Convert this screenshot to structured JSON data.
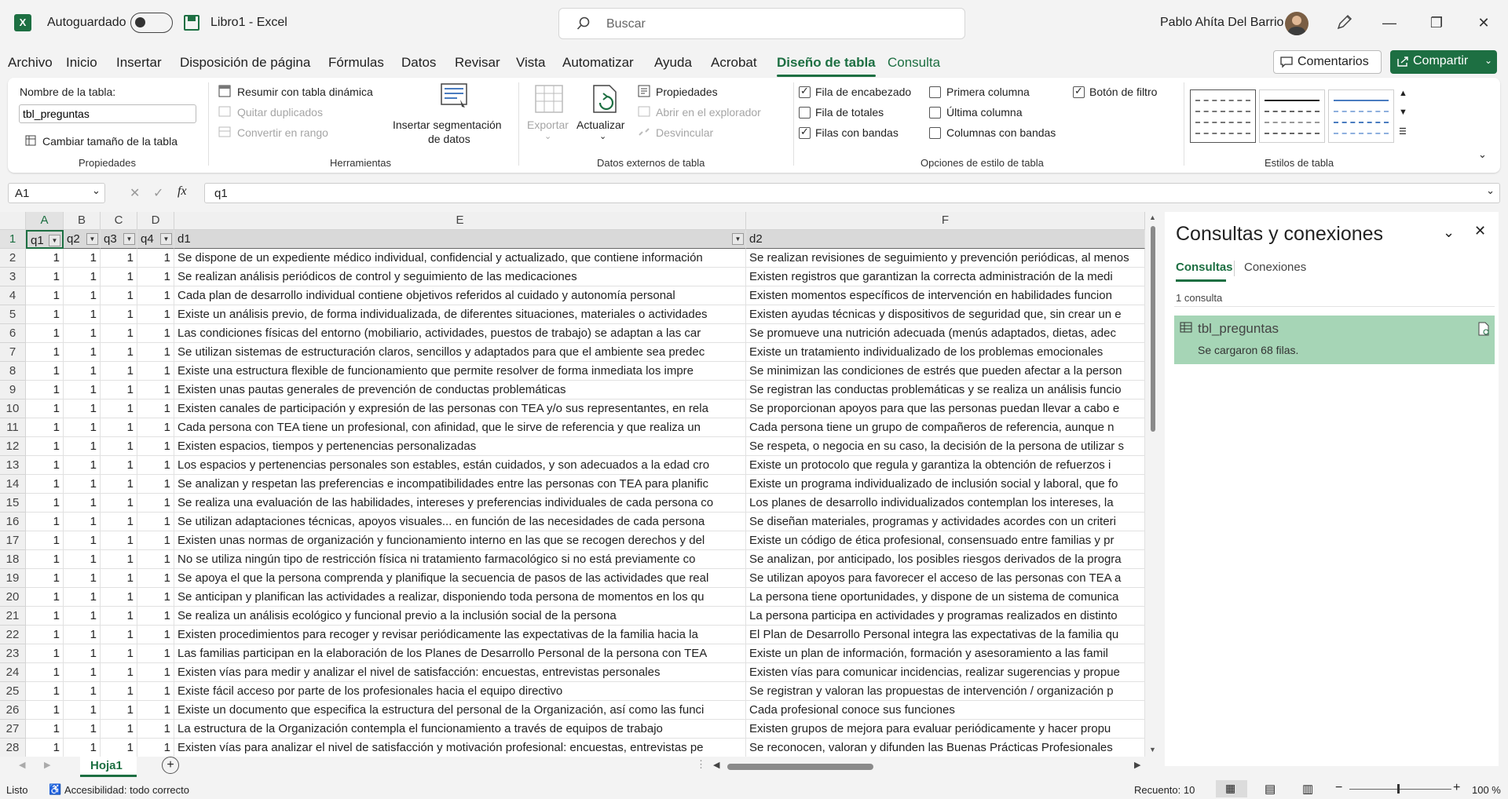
{
  "titlebar": {
    "app_logo": "X",
    "autosave_label": "Autoguardado",
    "autosave_state": "off",
    "doc_title": "Libro1  -  Excel",
    "search_placeholder": "Buscar",
    "user_name": "Pablo Ahíta Del Barrio"
  },
  "menu": {
    "tabs": [
      "Archivo",
      "Inicio",
      "Insertar",
      "Disposición de página",
      "Fórmulas",
      "Datos",
      "Revisar",
      "Vista",
      "Automatizar",
      "Ayuda",
      "Acrobat",
      "Diseño de tabla",
      "Consulta"
    ],
    "active_tab": "Diseño de tabla",
    "comments_label": "Comentarios",
    "share_label": "Compartir"
  },
  "ribbon": {
    "propiedades": {
      "table_name_label": "Nombre de la tabla:",
      "table_name_value": "tbl_preguntas",
      "resize_label": "Cambiar tamaño de la tabla",
      "group_label": "Propiedades"
    },
    "herramientas": {
      "pivot_label": "Resumir con tabla dinámica",
      "dedupe_label": "Quitar duplicados",
      "convert_label": "Convertir en rango",
      "slicer_label_1": "Insertar segmentación",
      "slicer_label_2": "de datos",
      "group_label": "Herramientas"
    },
    "datos_externos": {
      "export_label": "Exportar",
      "refresh_label": "Actualizar",
      "properties_label": "Propiedades",
      "open_browser_label": "Abrir en el explorador",
      "unlink_label": "Desvincular",
      "group_label": "Datos externos de tabla"
    },
    "opciones_estilo": {
      "header_row": "Fila de encabezado",
      "total_row": "Fila de totales",
      "banded_rows": "Filas con bandas",
      "first_col": "Primera columna",
      "last_col": "Última columna",
      "banded_cols": "Columnas con bandas",
      "filter_button": "Botón de filtro",
      "group_label": "Opciones de estilo de tabla"
    },
    "estilos": {
      "group_label": "Estilos de tabla"
    }
  },
  "formula": {
    "name_box": "A1",
    "fx": "fx",
    "content": "q1"
  },
  "grid": {
    "column_letters": [
      "A",
      "B",
      "C",
      "D",
      "E",
      "F"
    ],
    "header_row": [
      "q1",
      "q2",
      "q3",
      "q4",
      "d1",
      "d2"
    ],
    "rows": [
      {
        "n": "2",
        "q": [
          "1",
          "1",
          "1",
          "1"
        ],
        "d1": "Se dispone de un expediente médico individual, confidencial y actualizado, que contiene información",
        "d2": "Se realizan revisiones de seguimiento y prevención periódicas, al menos"
      },
      {
        "n": "3",
        "q": [
          "1",
          "1",
          "1",
          "1"
        ],
        "d1": "Se realizan análisis periódicos de control y seguimiento de las medicaciones",
        "d2": "Existen registros que garantizan la correcta administración de la medi"
      },
      {
        "n": "4",
        "q": [
          "1",
          "1",
          "1",
          "1"
        ],
        "d1": "Cada plan de desarrollo individual contiene objetivos referidos al cuidado y autonomía personal",
        "d2": "Existen momentos específicos de intervención en habilidades funcion"
      },
      {
        "n": "5",
        "q": [
          "1",
          "1",
          "1",
          "1"
        ],
        "d1": "Existe un análisis previo, de forma individualizada, de diferentes situaciones, materiales o actividades",
        "d2": "Existen ayudas técnicas y dispositivos de seguridad que, sin crear un e"
      },
      {
        "n": "6",
        "q": [
          "1",
          "1",
          "1",
          "1"
        ],
        "d1": "Las condiciones físicas del entorno (mobiliario, actividades, puestos de trabajo) se adaptan a las car",
        "d2": "Se promueve una nutrición adecuada (menús adaptados, dietas, adec"
      },
      {
        "n": "7",
        "q": [
          "1",
          "1",
          "1",
          "1"
        ],
        "d1": "Se utilizan sistemas de estructuración claros, sencillos y adaptados para que el ambiente sea predec",
        "d2": "Existe un tratamiento individualizado de los problemas emocionales"
      },
      {
        "n": "8",
        "q": [
          "1",
          "1",
          "1",
          "1"
        ],
        "d1": "Existe una estructura flexible de funcionamiento que permite resolver de forma inmediata los impre",
        "d2": "Se minimizan las condiciones de estrés que pueden afectar a la person"
      },
      {
        "n": "9",
        "q": [
          "1",
          "1",
          "1",
          "1"
        ],
        "d1": "Existen unas pautas generales de prevención de conductas problemáticas",
        "d2": "Se registran las conductas problemáticas y se realiza un análisis funcio"
      },
      {
        "n": "10",
        "q": [
          "1",
          "1",
          "1",
          "1"
        ],
        "d1": "Existen canales de participación y expresión de las personas con TEA y/o sus representantes, en rela",
        "d2": "Se proporcionan apoyos para que las personas puedan llevar a cabo e"
      },
      {
        "n": "11",
        "q": [
          "1",
          "1",
          "1",
          "1"
        ],
        "d1": "Cada persona con TEA tiene un profesional, con afinidad, que le sirve de referencia y que realiza un",
        "d2": "Cada persona tiene un grupo de compañeros de referencia, aunque n"
      },
      {
        "n": "12",
        "q": [
          "1",
          "1",
          "1",
          "1"
        ],
        "d1": "Existen espacios, tiempos y pertenencias personalizadas",
        "d2": "Se respeta, o negocia en su caso, la decisión de la persona de utilizar s"
      },
      {
        "n": "13",
        "q": [
          "1",
          "1",
          "1",
          "1"
        ],
        "d1": "Los espacios y pertenencias personales son estables, están cuidados, y son adecuados a la edad cro",
        "d2": "Existe un protocolo que regula y garantiza la obtención de refuerzos i"
      },
      {
        "n": "14",
        "q": [
          "1",
          "1",
          "1",
          "1"
        ],
        "d1": "Se analizan y respetan las preferencias e incompatibilidades entre las personas con TEA para planific",
        "d2": "Existe un programa individualizado de inclusión social y laboral, que fo"
      },
      {
        "n": "15",
        "q": [
          "1",
          "1",
          "1",
          "1"
        ],
        "d1": "Se realiza una evaluación de las habilidades, intereses y preferencias individuales de cada persona co",
        "d2": "Los planes de desarrollo individualizados contemplan los intereses, la"
      },
      {
        "n": "16",
        "q": [
          "1",
          "1",
          "1",
          "1"
        ],
        "d1": "Se utilizan adaptaciones técnicas, apoyos visuales... en función de las necesidades de cada persona",
        "d2": "Se diseñan materiales, programas y actividades acordes con un criteri"
      },
      {
        "n": "17",
        "q": [
          "1",
          "1",
          "1",
          "1"
        ],
        "d1": "Existen unas normas de organización y funcionamiento interno en las que se recogen derechos y del",
        "d2": "Existe un código de ética profesional, consensuado entre familias y pr"
      },
      {
        "n": "18",
        "q": [
          "1",
          "1",
          "1",
          "1"
        ],
        "d1": "No se utiliza ningún tipo de restricción física ni tratamiento farmacológico si no está previamente co",
        "d2": "Se analizan, por anticipado, los posibles riesgos derivados de la progra"
      },
      {
        "n": "19",
        "q": [
          "1",
          "1",
          "1",
          "1"
        ],
        "d1": "Se apoya el que la persona comprenda y planifique la secuencia de pasos de las actividades que real",
        "d2": "Se utilizan apoyos para favorecer el acceso de las personas con TEA a"
      },
      {
        "n": "20",
        "q": [
          "1",
          "1",
          "1",
          "1"
        ],
        "d1": "Se anticipan y planifican las actividades a realizar, disponiendo toda persona de momentos en los qu",
        "d2": "La persona tiene oportunidades, y dispone de un sistema de comunica"
      },
      {
        "n": "21",
        "q": [
          "1",
          "1",
          "1",
          "1"
        ],
        "d1": "Se realiza un análisis ecológico y funcional previo a la inclusión social de la persona",
        "d2": "La persona participa en actividades y programas realizados en distinto"
      },
      {
        "n": "22",
        "q": [
          "1",
          "1",
          "1",
          "1"
        ],
        "d1": "Existen procedimientos para recoger y revisar periódicamente las expectativas de la familia hacia la",
        "d2": "El Plan de Desarrollo Personal integra las expectativas de la familia qu"
      },
      {
        "n": "23",
        "q": [
          "1",
          "1",
          "1",
          "1"
        ],
        "d1": "Las familias participan en la elaboración de los Planes de Desarrollo Personal de la persona con TEA",
        "d2": "Existe un plan de información, formación y asesoramiento a las famil"
      },
      {
        "n": "24",
        "q": [
          "1",
          "1",
          "1",
          "1"
        ],
        "d1": "Existen vías para medir y analizar el nivel de satisfacción: encuestas, entrevistas personales",
        "d2": "Existen vías para comunicar incidencias, realizar sugerencias y propue"
      },
      {
        "n": "25",
        "q": [
          "1",
          "1",
          "1",
          "1"
        ],
        "d1": "Existe fácil acceso por parte de los profesionales hacia el equipo directivo",
        "d2": "Se registran y valoran las propuestas de intervención / organización p"
      },
      {
        "n": "26",
        "q": [
          "1",
          "1",
          "1",
          "1"
        ],
        "d1": "Existe un documento que especifica la estructura del personal de la Organización, así como las funci",
        "d2": "Cada profesional conoce sus funciones"
      },
      {
        "n": "27",
        "q": [
          "1",
          "1",
          "1",
          "1"
        ],
        "d1": "La estructura de la Organización contempla el funcionamiento a través de equipos de trabajo",
        "d2": "Existen grupos de mejora para evaluar periódicamente y hacer propu"
      },
      {
        "n": "28",
        "q": [
          "1",
          "1",
          "1",
          "1"
        ],
        "d1": "Existen vías para analizar el nivel de satisfacción y motivación profesional: encuestas, entrevistas pe",
        "d2": "Se reconocen, valoran y difunden las Buenas Prácticas Profesionales"
      }
    ]
  },
  "pane": {
    "title": "Consultas y conexiones",
    "tab_queries": "Consultas",
    "tab_connections": "Conexiones",
    "count": "1 consulta",
    "query_name": "tbl_preguntas",
    "query_status": "Se cargaron 68 filas."
  },
  "sheets": {
    "active": "Hoja1"
  },
  "status": {
    "ready": "Listo",
    "accessibility": "Accesibilidad: todo correcto",
    "count": "Recuento: 10",
    "zoom": "100 %"
  }
}
